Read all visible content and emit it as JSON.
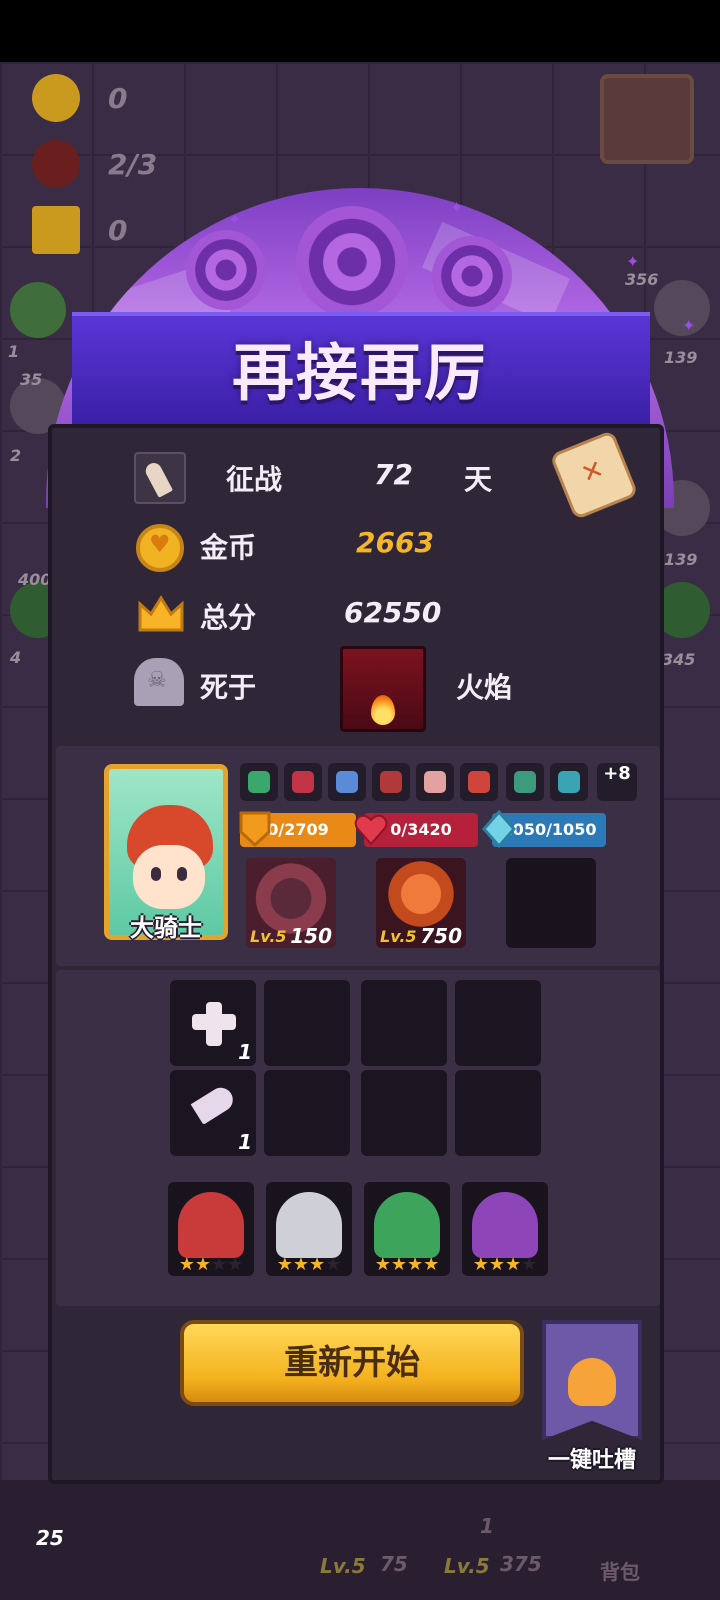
{
  "background": {
    "stats": [
      {
        "icon": "heart-coin-icon",
        "value": "0"
      },
      {
        "icon": "demon-icon",
        "value": "2/3"
      },
      {
        "icon": "crown-icon",
        "value": "0"
      }
    ],
    "side_numbers": [
      "356",
      "139",
      "35",
      "2",
      "1",
      "139",
      "400",
      "4",
      "345"
    ],
    "bottom": {
      "left_num": "25",
      "mid_lv": "Lv.5",
      "mid_val": "75",
      "right_lv": "Lv.5",
      "right_val": "375",
      "right_count": "1",
      "bag_label": "背包"
    }
  },
  "banner": {
    "title": "再接再厉"
  },
  "summary": {
    "days": {
      "label": "征战",
      "value": "72",
      "unit": "天"
    },
    "gold": {
      "label": "金币",
      "value": "2663"
    },
    "score": {
      "label": "总分",
      "value": "62550"
    },
    "death": {
      "label": "死于",
      "cause": "火焰"
    }
  },
  "hero": {
    "name": "大骑士",
    "relics_more": "+8",
    "relic_colors": [
      "#3aa86a",
      "#c23447",
      "#5b8bd6",
      "#b03a3a",
      "#e2a2a2",
      "#d0453b",
      "#3e9a7d",
      "#3aa4b4"
    ],
    "bars": {
      "shield": "0/2709",
      "hp": "0/3420",
      "mana": "1050/1050"
    },
    "skills": [
      {
        "lv": "Lv.5",
        "value": "150",
        "icon": "shadow-monster-icon"
      },
      {
        "lv": "Lv.5",
        "value": "750",
        "icon": "horn-icon"
      }
    ]
  },
  "inventory": {
    "items": [
      {
        "icon": "cross-icon",
        "count": "1"
      },
      {
        "icon": "knife-icon",
        "count": "1"
      }
    ]
  },
  "allies": [
    {
      "icon": "red-wizard-icon",
      "stars": 2,
      "color": "#c93a3a"
    },
    {
      "icon": "knight-helmet-icon",
      "stars": 3,
      "color": "#cfcfd8"
    },
    {
      "icon": "green-owl-icon",
      "stars": 4,
      "color": "#3da45c"
    },
    {
      "icon": "purple-reaper-icon",
      "stars": 3,
      "color": "#8e45b8"
    }
  ],
  "actions": {
    "restart": "重新开始",
    "feedback": "一键吐槽"
  }
}
